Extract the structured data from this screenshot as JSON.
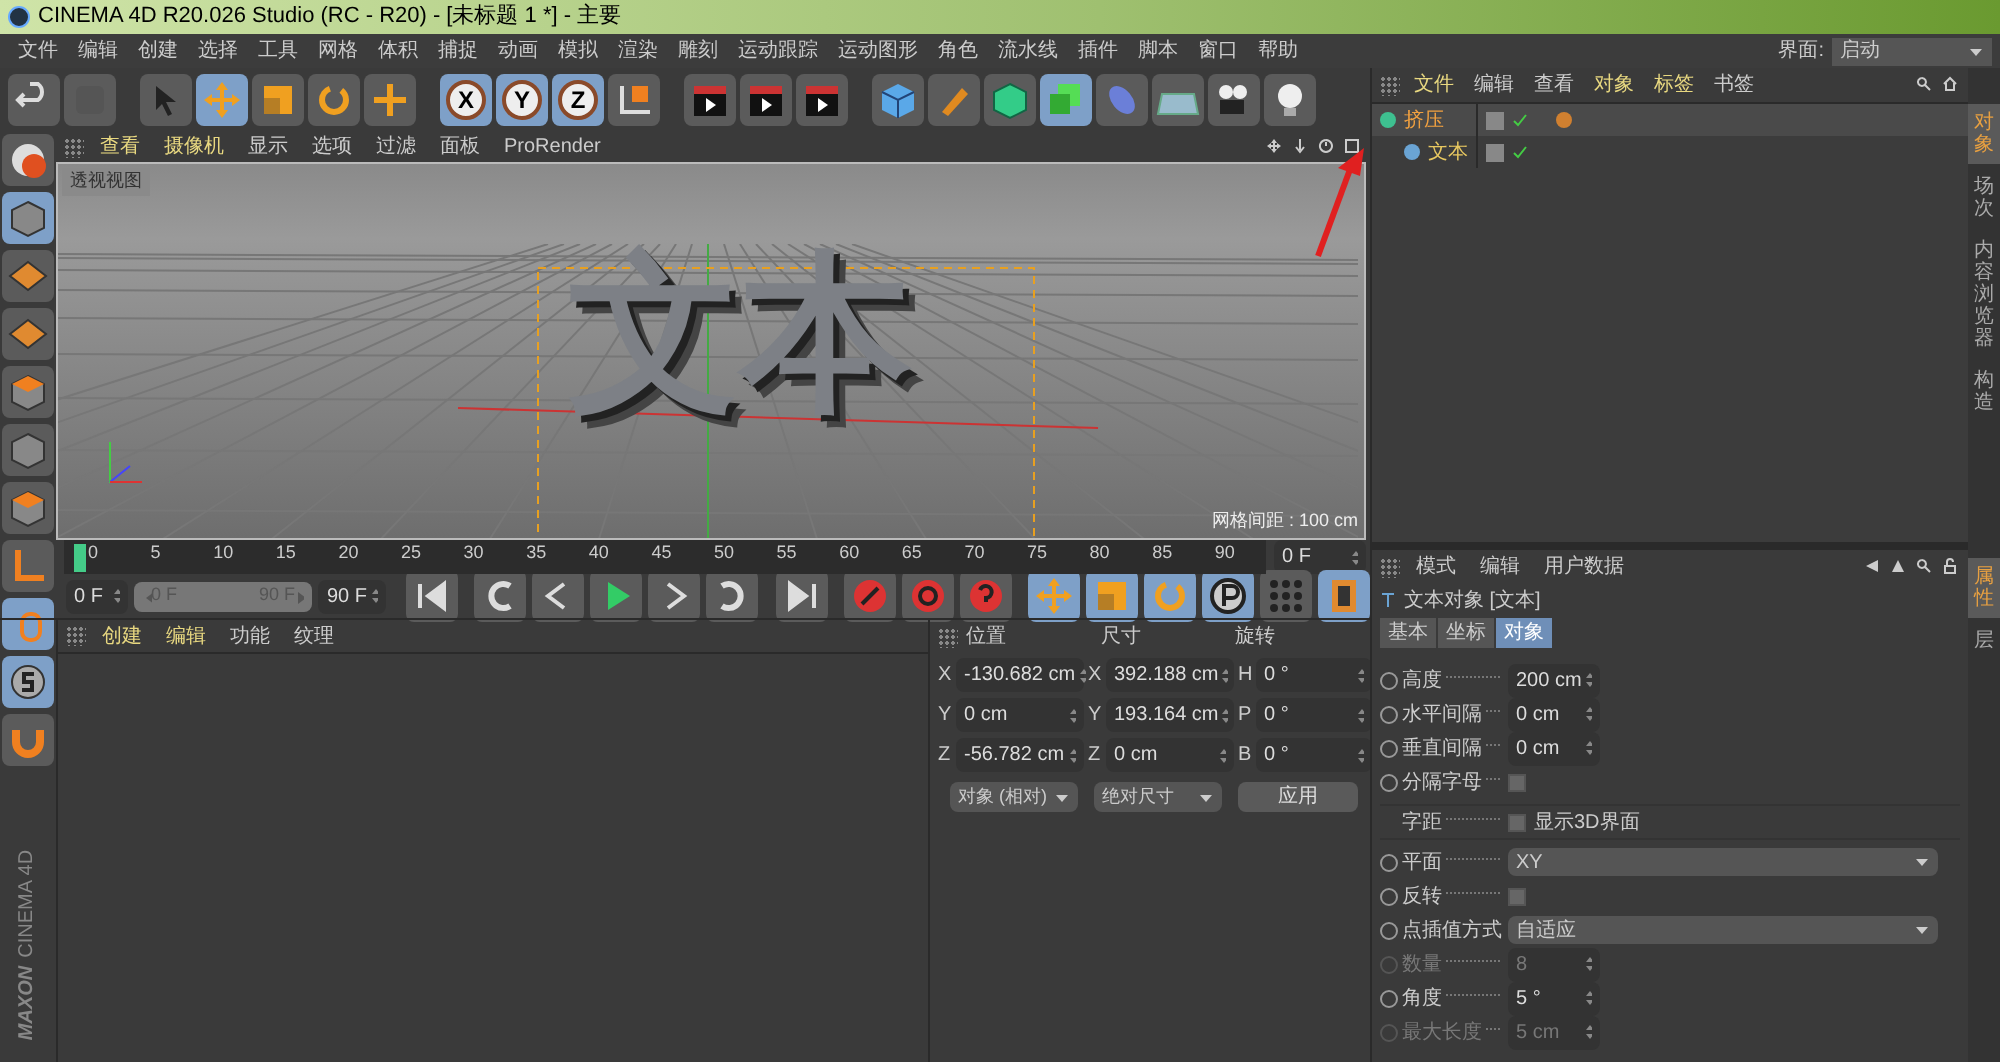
{
  "window": {
    "title": "CINEMA 4D R20.026 Studio (RC - R20) - [未标题 1 *] - 主要"
  },
  "menu": [
    "文件",
    "编辑",
    "创建",
    "选择",
    "工具",
    "网格",
    "体积",
    "捕捉",
    "动画",
    "模拟",
    "渲染",
    "雕刻",
    "运动跟踪",
    "运动图形",
    "角色",
    "流水线",
    "插件",
    "脚本",
    "窗口",
    "帮助"
  ],
  "layout_label": "界面:",
  "layout_value": "启动",
  "axis_buttons": [
    "X",
    "Y",
    "Z"
  ],
  "viewport": {
    "menu": [
      "查看",
      "摄像机",
      "显示",
      "选项",
      "过滤",
      "面板",
      "ProRender"
    ],
    "view_label": "透视视图",
    "grid_label": "网格间距 : 100 cm",
    "scene_text": "文本"
  },
  "timeline": {
    "ticks": [
      "0",
      "5",
      "10",
      "15",
      "20",
      "25",
      "30",
      "35",
      "40",
      "45",
      "50",
      "55",
      "60",
      "65",
      "70",
      "75",
      "80",
      "85",
      "90"
    ],
    "current_frame": "0 F",
    "start": "0 F",
    "range_start": "0 F",
    "range_slider": {
      "level": 1
    },
    "range_end": "90 F",
    "end": "90 F"
  },
  "material_manager": {
    "menu": [
      "创建",
      "编辑",
      "功能",
      "纹理"
    ]
  },
  "coordinates": {
    "headers": [
      "位置",
      "尺寸",
      "旋转"
    ],
    "columns": [
      [
        {
          "axis": "X",
          "value": "-130.682 cm"
        },
        {
          "axis": "Y",
          "value": "0 cm"
        },
        {
          "axis": "Z",
          "value": "-56.782 cm"
        }
      ],
      [
        {
          "axis": "X",
          "value": "392.188 cm"
        },
        {
          "axis": "Y",
          "value": "193.164 cm"
        },
        {
          "axis": "Z",
          "value": "0 cm"
        }
      ],
      [
        {
          "axis": "H",
          "value": "0 °"
        },
        {
          "axis": "P",
          "value": "0 °"
        },
        {
          "axis": "B",
          "value": "0 °"
        }
      ]
    ],
    "mode": "对象 (相对)",
    "size_mode": "绝对尺寸",
    "apply": "应用"
  },
  "logo": {
    "brand": "MAXON",
    "product": "CINEMA 4D"
  },
  "object_manager": {
    "menu": [
      "文件",
      "编辑",
      "查看",
      "对象",
      "标签",
      "书签"
    ],
    "objects": [
      {
        "name": "挤压",
        "selected": true,
        "children": [
          {
            "name": "文本",
            "selected": false
          }
        ]
      }
    ]
  },
  "side_tabs": [
    "对象",
    "场次",
    "内容浏览器",
    "构造"
  ],
  "attributes": {
    "menu": [
      "模式",
      "编辑",
      "用户数据"
    ],
    "title": "文本对象 [文本]",
    "tabs": [
      {
        "label": "基本",
        "selected": false
      },
      {
        "label": "坐标",
        "selected": false
      },
      {
        "label": "对象",
        "selected": true
      }
    ],
    "params": [
      {
        "kind": "number",
        "label": "高度",
        "value": "200 cm",
        "disabled": false
      },
      {
        "kind": "number",
        "label": "水平间隔",
        "value": "0 cm",
        "disabled": false
      },
      {
        "kind": "number",
        "label": "垂直间隔",
        "value": "0 cm",
        "disabled": false
      },
      {
        "kind": "check",
        "label": "分隔字母",
        "checked": false
      },
      {
        "kind": "spacing",
        "label": "字距",
        "option": "显示3D界面",
        "checked": false
      },
      {
        "kind": "dropdown",
        "label": "平面",
        "value": "XY"
      },
      {
        "kind": "check",
        "label": "反转",
        "checked": false
      },
      {
        "kind": "dropdown",
        "label": "点插值方式",
        "value": "自适应"
      },
      {
        "kind": "number",
        "label": "数量",
        "value": "8",
        "disabled": true
      },
      {
        "kind": "number",
        "label": "角度",
        "value": "5 °",
        "disabled": false
      },
      {
        "kind": "number",
        "label": "最大长度",
        "value": "5 cm",
        "disabled": true
      }
    ]
  },
  "attribute_side_tabs": [
    "属性",
    "层"
  ]
}
